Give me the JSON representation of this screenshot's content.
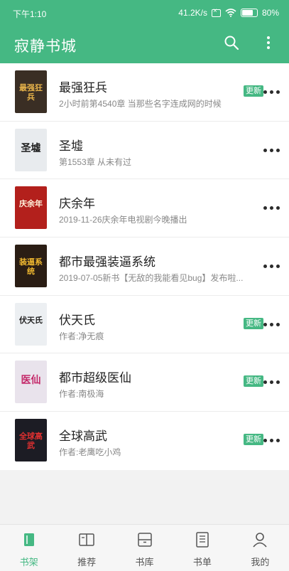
{
  "status_bar": {
    "time": "下午1:10",
    "speed": "41.2K/s",
    "battery": "80%",
    "battery_level": 0.8
  },
  "app_bar": {
    "title": "寂静书城",
    "actions": [
      "search-icon",
      "more-vert-icon"
    ]
  },
  "colors": {
    "accent": "#45b883",
    "badge": "#45b883"
  },
  "books": [
    {
      "title": "最强狂兵",
      "subtitle": "2小时前第4540章 当那些名字连成网的时候",
      "badge": "更新",
      "cover_text": "最强狂兵",
      "cover_bg": "#3a2e24",
      "cover_color": "#e6b24a"
    },
    {
      "title": "圣墟",
      "subtitle": "第1553章 从未有过",
      "badge": "",
      "cover_text": "圣墟",
      "cover_bg": "#e8ebee",
      "cover_color": "#1a1a1a"
    },
    {
      "title": "庆余年",
      "subtitle": "2019-11-26庆余年电视剧今晚播出",
      "badge": "",
      "cover_text": "庆余年",
      "cover_bg": "#b3201c",
      "cover_color": "#fff2dc"
    },
    {
      "title": "都市最强装逼系统",
      "subtitle": "2019-07-05新书【无敌的我能看见bug】发布啦...",
      "badge": "",
      "cover_text": "装逼系统",
      "cover_bg": "#2a1d14",
      "cover_color": "#f0b830"
    },
    {
      "title": "伏天氏",
      "subtitle": "作者:净无痕",
      "badge": "更新",
      "cover_text": "伏天氏",
      "cover_bg": "#eceff2",
      "cover_color": "#222222"
    },
    {
      "title": "都市超级医仙",
      "subtitle": "作者:南极海",
      "badge": "更新",
      "cover_text": "医仙",
      "cover_bg": "#e9e3ec",
      "cover_color": "#c42a6a"
    },
    {
      "title": "全球高武",
      "subtitle": "作者:老鹰吃小鸡",
      "badge": "更新",
      "cover_text": "全球高武",
      "cover_bg": "#1c1c24",
      "cover_color": "#e03030"
    }
  ],
  "bottom_nav": [
    {
      "label": "书架",
      "icon": "bookshelf-icon",
      "active": true
    },
    {
      "label": "推荐",
      "icon": "open-book-icon",
      "active": false
    },
    {
      "label": "书库",
      "icon": "library-icon",
      "active": false
    },
    {
      "label": "书单",
      "icon": "booklist-icon",
      "active": false
    },
    {
      "label": "我的",
      "icon": "user-icon",
      "active": false
    }
  ]
}
